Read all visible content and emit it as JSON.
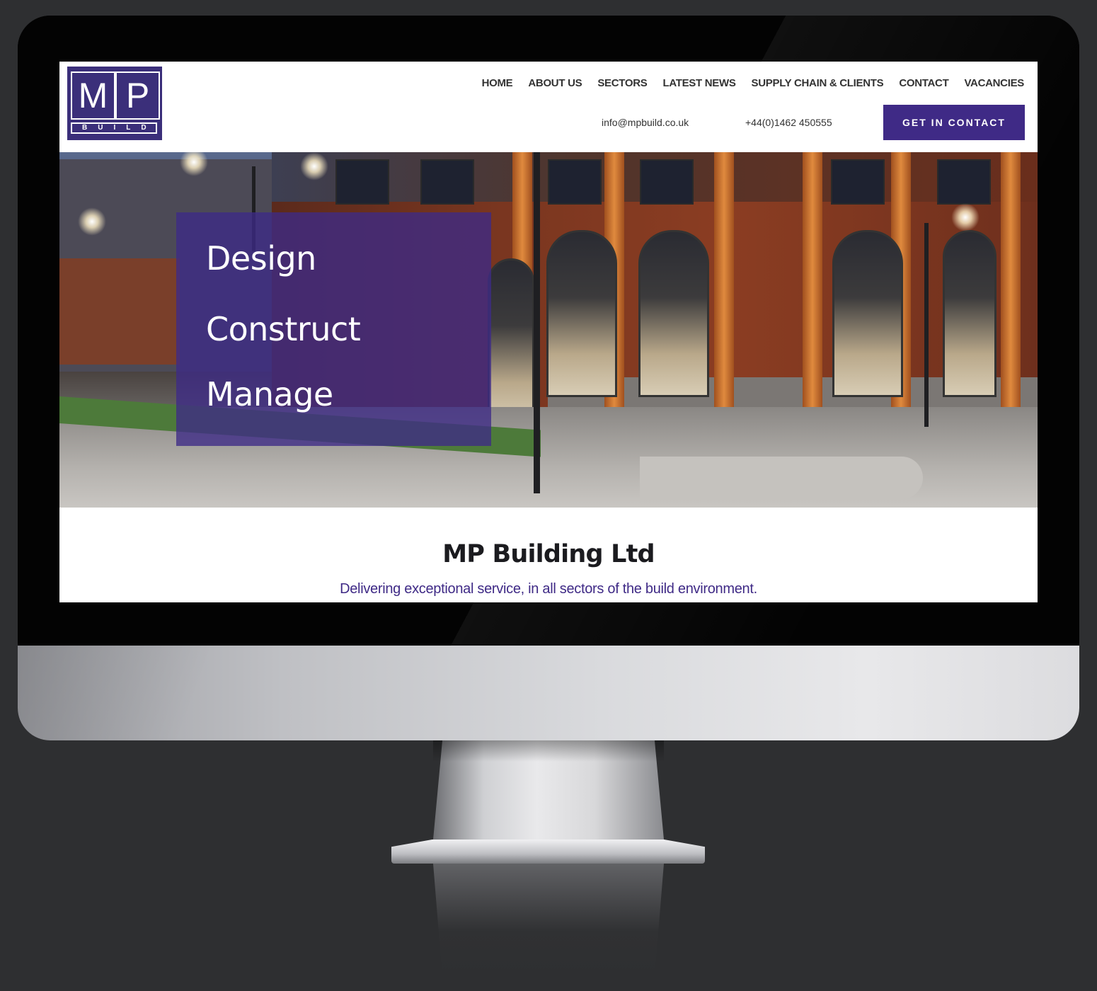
{
  "site": {
    "logo": {
      "letter_left": "M",
      "letter_right": "P",
      "tagline": "BUILD"
    },
    "nav": [
      {
        "label": "HOME"
      },
      {
        "label": "ABOUT US"
      },
      {
        "label": "SECTORS"
      },
      {
        "label": "LATEST NEWS"
      },
      {
        "label": "SUPPLY CHAIN & CLIENTS"
      },
      {
        "label": "CONTACT"
      },
      {
        "label": "VACANCIES"
      }
    ],
    "contact": {
      "email": "info@mpbuild.co.uk",
      "phone": "+44(0)1462 450555",
      "cta_label": "GET IN CONTACT"
    },
    "hero": {
      "words": [
        "Design",
        "Construct",
        "Manage"
      ]
    },
    "intro": {
      "title": "MP Building Ltd",
      "subtitle": "Delivering exceptional service, in all sectors of the build environment."
    },
    "colors": {
      "brand_purple": "#3f2a86",
      "logo_purple": "#3b2f7a",
      "background": "#2e2f31"
    }
  }
}
